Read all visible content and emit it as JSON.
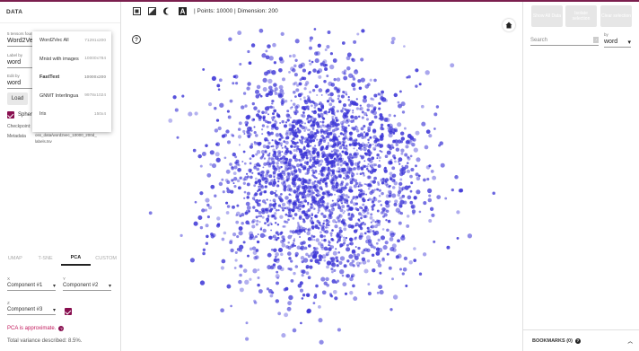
{
  "left": {
    "header": "DATA",
    "tensor_label": "5 tensors found",
    "tensor_value": "Word2Vec",
    "label_by_label": "Label by",
    "label_by_value": "word",
    "edit_by_label": "Edit by",
    "edit_by_value": "word",
    "load_button": "Load",
    "sphereize_label": "Sphere",
    "checkpoint_label": "Checkpoint:",
    "metadata_label": "Metadata",
    "metadata_value_1": "oss_data/word2vec_10000_200d_",
    "metadata_value_2": "labels.tsv",
    "dropdown": [
      {
        "name": "Word2Vec All",
        "size": "71291x200"
      },
      {
        "name": "Mnist with images",
        "size": "10000x784"
      },
      {
        "name": "FastText",
        "size": "10000x200"
      },
      {
        "name": "GNMT Interlingua",
        "size": "9978x1024"
      },
      {
        "name": "Iris",
        "size": "150x4"
      }
    ],
    "tabs": [
      "UMAP",
      "T-SNE",
      "PCA",
      "CUSTOM"
    ],
    "x_label": "X",
    "x_value": "Component #1",
    "y_label": "Y",
    "y_value": "Component #2",
    "z_label": "Z",
    "z_value": "Component #3",
    "approx_text": "PCA is approximate.",
    "variance_text": "Total variance described: 8.5%."
  },
  "toolbar": {
    "points_text": "| Points: 10000 | Dimension: 200"
  },
  "right": {
    "show_all": "Show All Data",
    "isolate": "Isolate selection",
    "clear": "Clear selection",
    "search_placeholder": "Search",
    "by_label": "by",
    "by_value": "word",
    "bookmarks": "BOOKMARKS (0)"
  },
  "colors": {
    "accent": "#880e4f",
    "points": "#3b34d6"
  }
}
